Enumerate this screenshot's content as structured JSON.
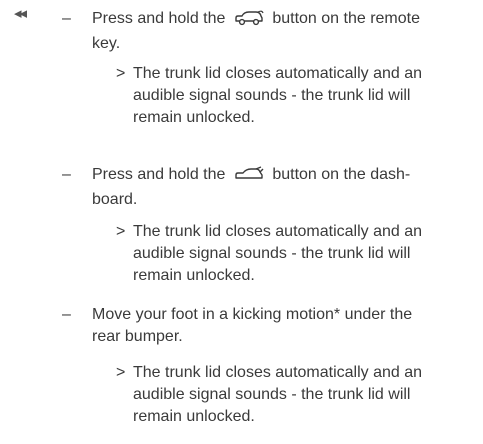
{
  "continued_marker": "◂◂",
  "steps": [
    {
      "dash": "–",
      "text_before": "Press and hold the",
      "icon": "trunk-remote-key-icon",
      "text_after": "button on the remote key.",
      "result_marker": ">",
      "result": "The trunk lid closes automatically and an audible signal sounds - the trunk lid will remain unlocked."
    },
    {
      "dash": "–",
      "text_before": "Press and hold the",
      "icon": "trunk-dashboard-icon",
      "text_after": "button on the dash-board.",
      "result_marker": ">",
      "result": "The trunk lid closes automatically and an audible signal sounds - the trunk lid will remain unlocked."
    },
    {
      "dash": "–",
      "text": "Move your foot in a kicking motion* under the rear bumper.",
      "result_marker": ">",
      "result": "The trunk lid closes automatically and an audible signal sounds - the trunk lid will remain unlocked."
    }
  ]
}
